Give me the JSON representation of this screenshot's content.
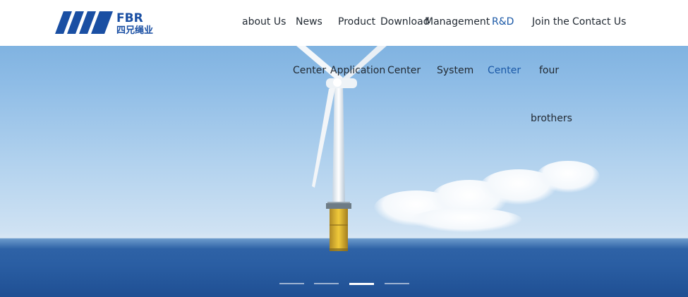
{
  "brand": {
    "logo_text": "FBR",
    "logo_cn": "四兄绳业",
    "color": "#1a4fa3"
  },
  "nav": {
    "items": [
      {
        "id": "about",
        "lines": [
          "about Us"
        ]
      },
      {
        "id": "news",
        "lines": [
          "News",
          "Center"
        ]
      },
      {
        "id": "product",
        "lines": [
          "Product",
          "Application"
        ]
      },
      {
        "id": "download",
        "lines": [
          "Download",
          "Center"
        ]
      },
      {
        "id": "management",
        "lines": [
          "Management",
          "System"
        ]
      },
      {
        "id": "rd",
        "lines": [
          "R&D",
          "Center"
        ]
      },
      {
        "id": "join",
        "lines": [
          "Join the",
          "four",
          "brothers"
        ]
      },
      {
        "id": "contact",
        "lines": [
          "Contact Us"
        ]
      }
    ],
    "active_id": "rd",
    "active_color": "#1a58a6",
    "text_color": "#222a33"
  },
  "carousel": {
    "slide_count": 4,
    "active_index": 2
  }
}
